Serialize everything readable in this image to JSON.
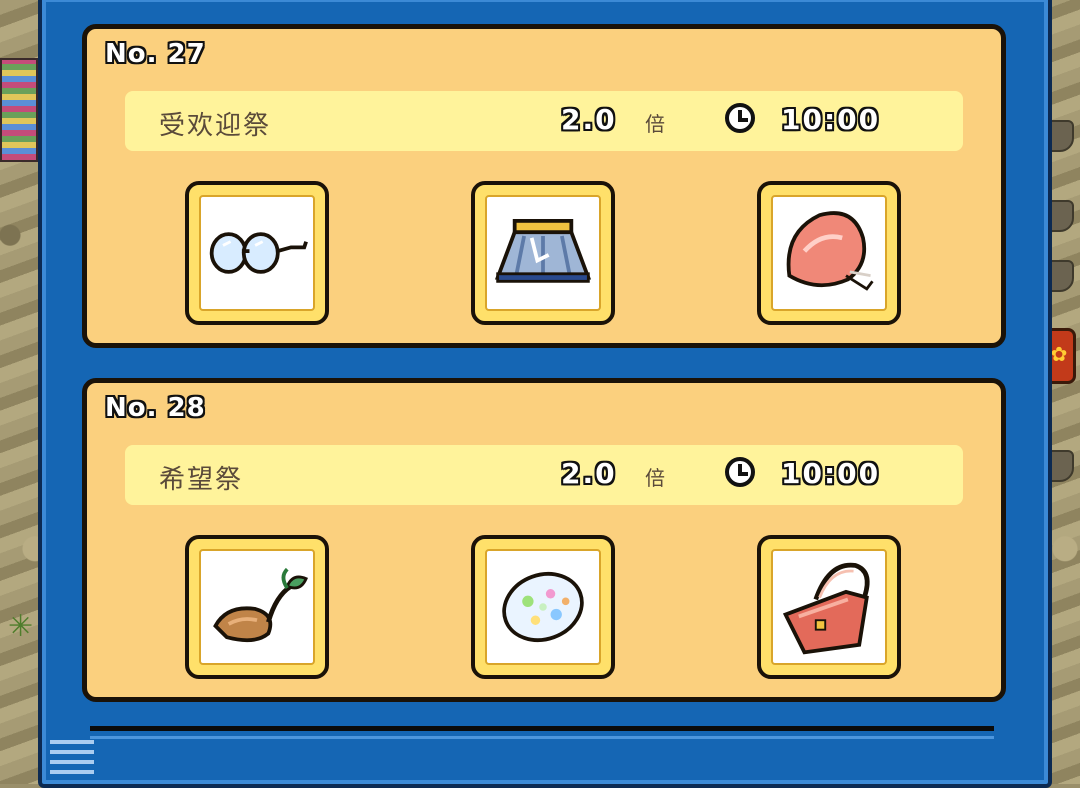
{
  "cards": [
    {
      "number": "No. 27",
      "festival": "受欢迎祭",
      "multiplier": "2.0",
      "multiplier_unit": "倍",
      "time": "10:00",
      "items": [
        "glasses-icon",
        "skirt-icon",
        "cap-icon"
      ]
    },
    {
      "number": "No. 28",
      "festival": "希望祭",
      "multiplier": "2.0",
      "multiplier_unit": "倍",
      "time": "10:00",
      "items": [
        "seed-sprout-icon",
        "opal-gem-icon",
        "handbag-icon"
      ]
    }
  ],
  "colors": {
    "window_blue": "#1566b4",
    "card_bg": "#fbd07e",
    "info_bg": "#fff39b",
    "slot_frame": "#ffe06a"
  }
}
